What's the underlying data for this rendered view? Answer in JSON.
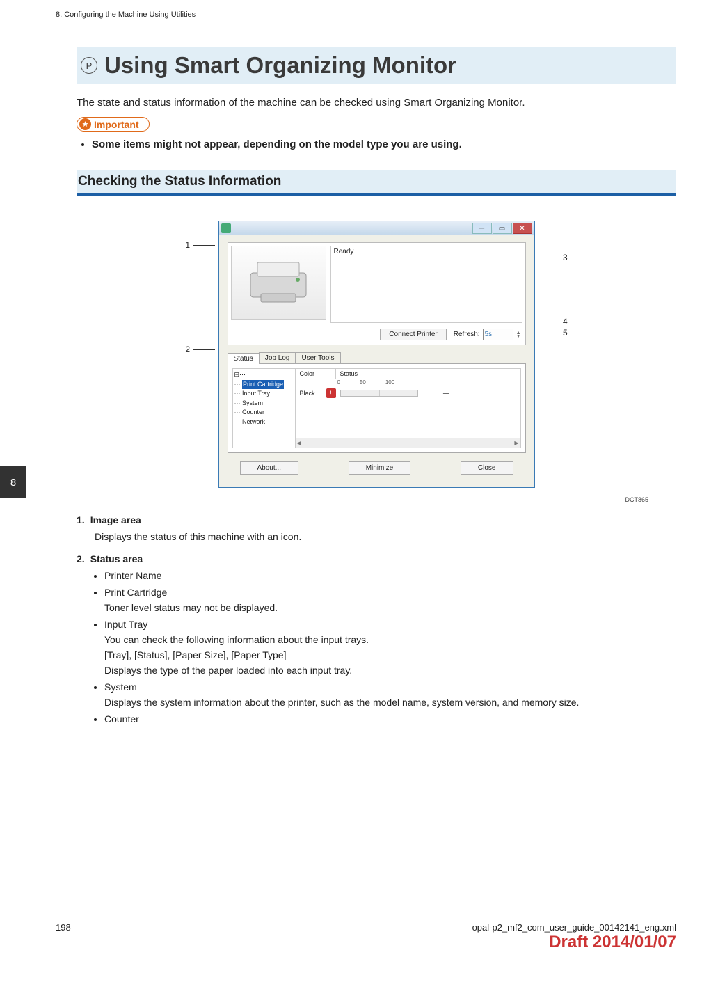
{
  "header": {
    "running_head": "8. Configuring the Machine Using Utilities",
    "chapter_tab": "8"
  },
  "title": {
    "badge": "P",
    "text": "Using Smart Organizing Monitor"
  },
  "intro": "The state and status information of the machine can be checked using Smart Organizing Monitor.",
  "important": {
    "label": "Important",
    "items": [
      "Some items might not appear, depending on the model type you are using."
    ]
  },
  "section_head": "Checking the Status Information",
  "callouts": {
    "c1": "1",
    "c2": "2",
    "c3": "3",
    "c4": "4",
    "c5": "5"
  },
  "app": {
    "status_text": "Ready",
    "connect_btn": "Connect Printer",
    "refresh_label": "Refresh:",
    "refresh_value": "5s",
    "tabs": {
      "status": "Status",
      "joblog": "Job Log",
      "usertools": "User Tools"
    },
    "tree": {
      "root_expand": "⊟⋯",
      "cartridge": "Print Cartridge",
      "input_tray": "Input Tray",
      "system": "System",
      "counter": "Counter",
      "network": "Network"
    },
    "detail_head": {
      "color": "Color",
      "status": "Status"
    },
    "scale": {
      "s0": "0",
      "s50": "50",
      "s100": "100"
    },
    "row": {
      "label": "Black",
      "value": "---"
    },
    "buttons": {
      "about": "About...",
      "minimize": "Minimize",
      "close": "Close"
    }
  },
  "figcode": "DCT865",
  "defs": {
    "d1": {
      "num": "1.",
      "title": "Image area",
      "desc": "Displays the status of this machine with an icon."
    },
    "d2": {
      "num": "2.",
      "title": "Status area",
      "items": {
        "printer_name": "Printer Name",
        "print_cartridge": "Print Cartridge",
        "print_cartridge_desc": "Toner level status may not be displayed.",
        "input_tray": "Input Tray",
        "input_tray_d1": "You can check the following information about the input trays.",
        "input_tray_d2": "[Tray], [Status], [Paper Size], [Paper Type]",
        "input_tray_d3": "Displays the type of the paper loaded into each input tray.",
        "system": "System",
        "system_desc": "Displays the system information about the printer, such as the model name, system version, and memory size.",
        "counter": "Counter"
      }
    }
  },
  "footer": {
    "page": "198",
    "file": "opal-p2_mf2_com_user_guide_00142141_eng.xml",
    "draft": "Draft 2014/01/07"
  }
}
